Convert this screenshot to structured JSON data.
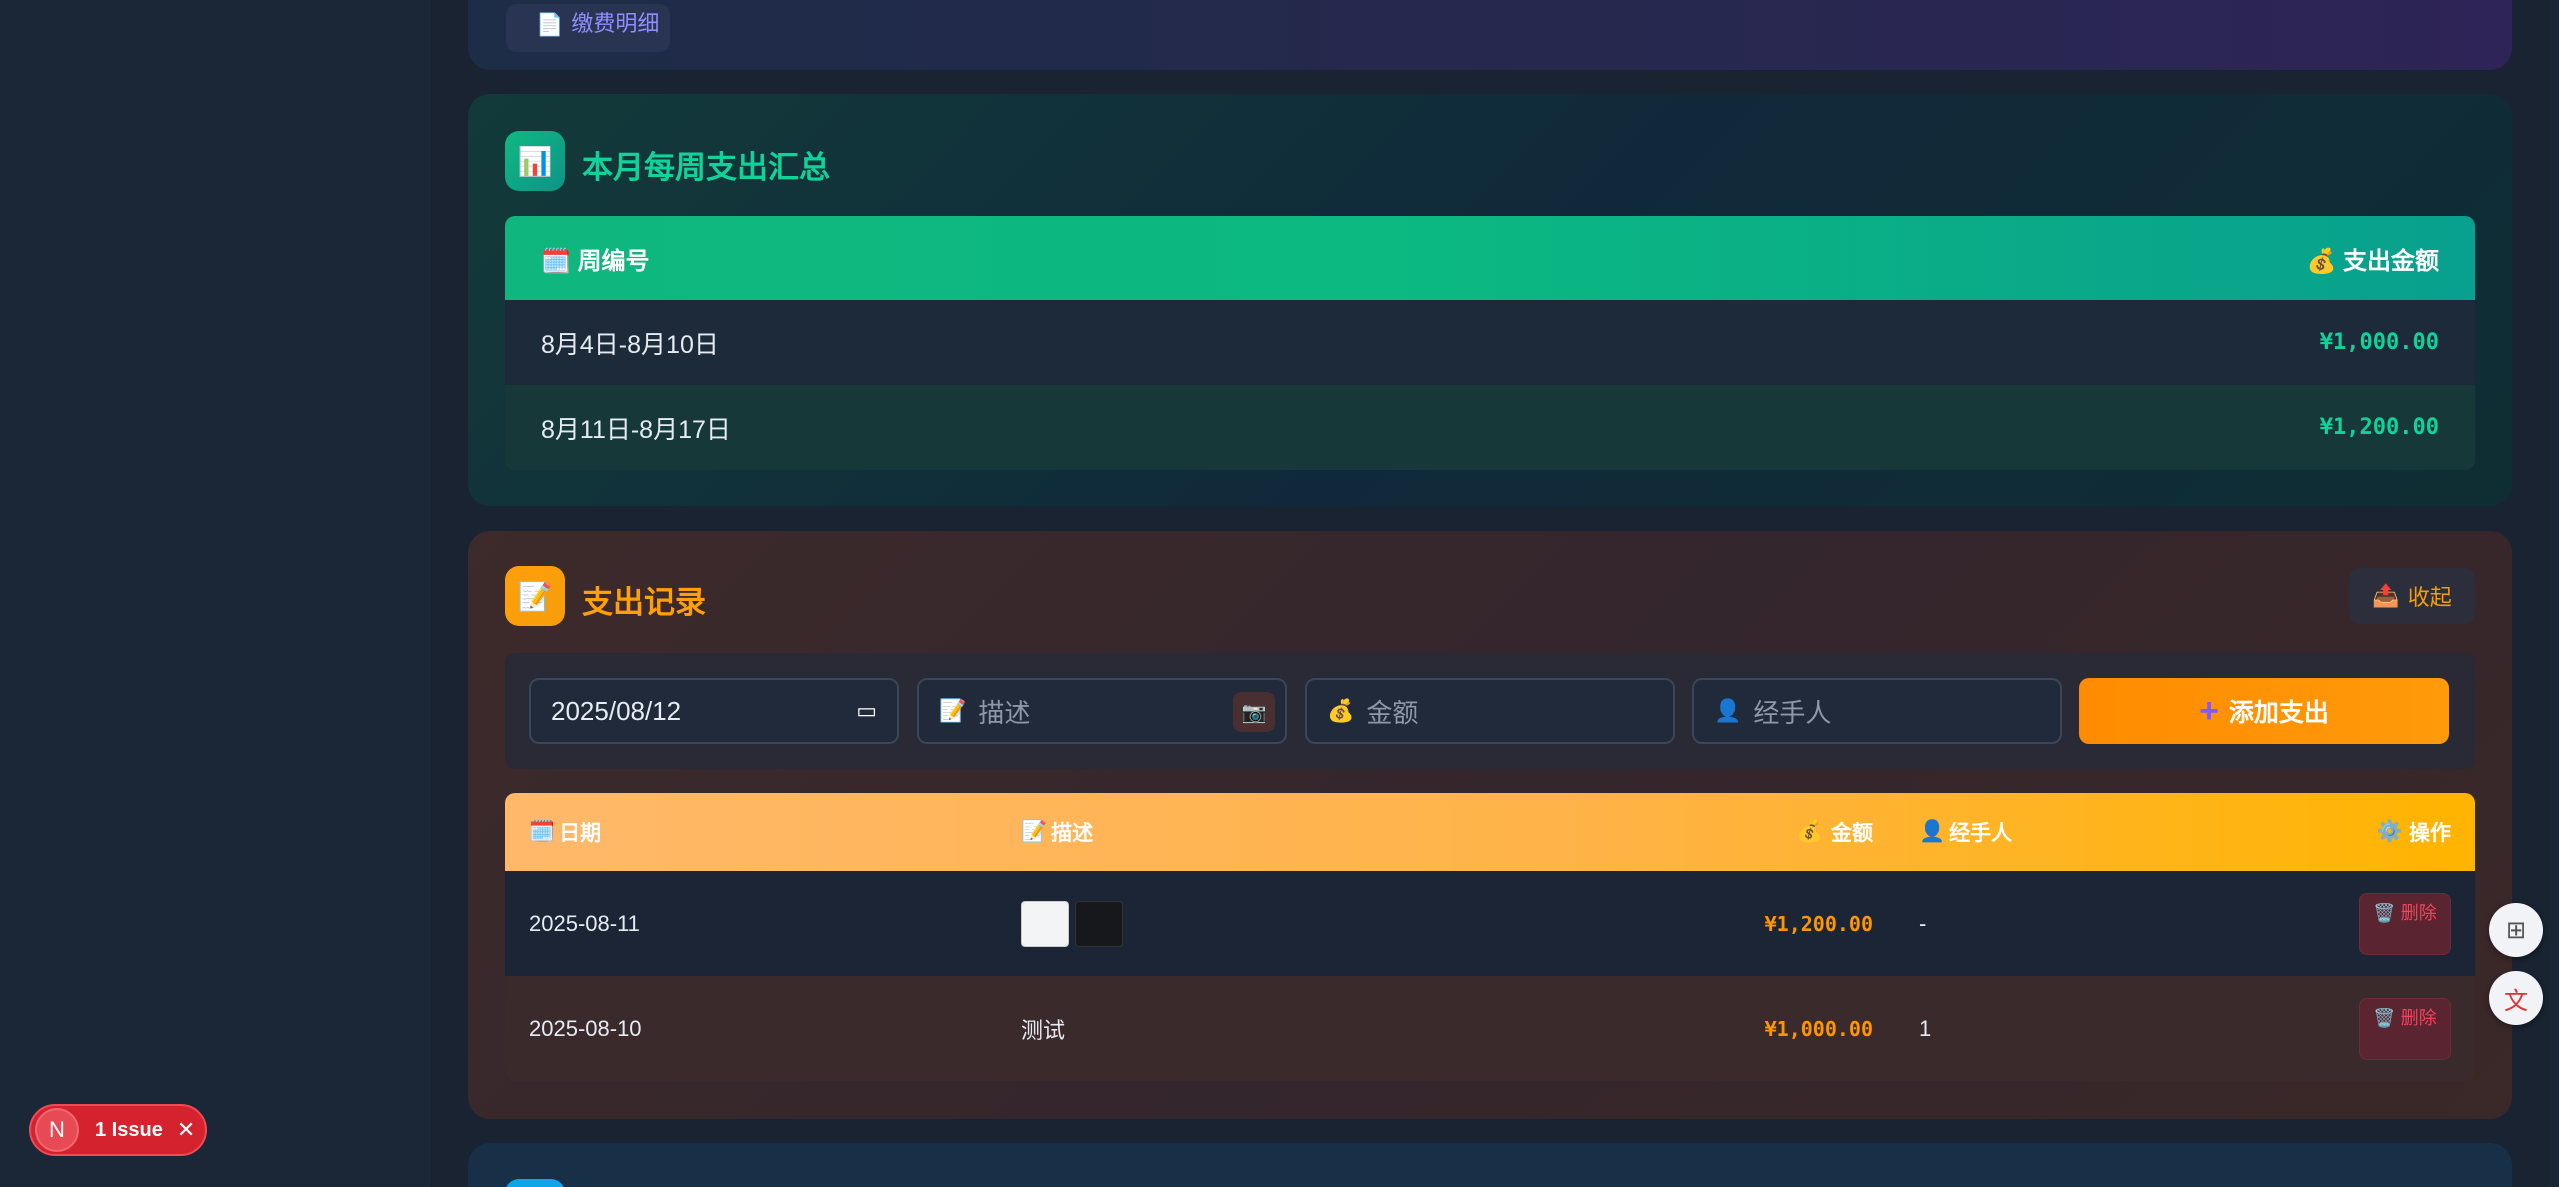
{
  "top_card": {
    "link_label": "缴费明细"
  },
  "weekly": {
    "title": "本月每周支出汇总",
    "col_week": "周编号",
    "col_amount": "支出金额",
    "rows": [
      {
        "week": "8月4日-8月10日",
        "amount": "¥1,000.00"
      },
      {
        "week": "8月11日-8月17日",
        "amount": "¥1,200.00"
      }
    ]
  },
  "expenses": {
    "title": "支出记录",
    "collapse_label": "收起",
    "form": {
      "date_value": "2025/08/12",
      "desc_placeholder": "描述",
      "amount_placeholder": "金额",
      "handler_placeholder": "经手人",
      "add_label": "添加支出"
    },
    "columns": {
      "date": "日期",
      "desc": "描述",
      "amount": "金额",
      "handler": "经手人",
      "op": "操作"
    },
    "rows": [
      {
        "date": "2025-08-11",
        "desc": "",
        "amount": "¥1,200.00",
        "handler": "-",
        "delete_label": "删除"
      },
      {
        "date": "2025-08-10",
        "desc": "测试",
        "amount": "¥1,000.00",
        "handler": "1",
        "delete_label": "删除"
      }
    ]
  },
  "issue_badge": {
    "letter": "N",
    "label": "1 Issue"
  },
  "colors": {
    "green": "#10b981",
    "orange": "#ff8c00",
    "danger": "#d5222f"
  }
}
